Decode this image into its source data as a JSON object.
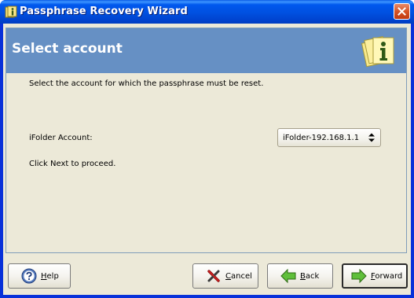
{
  "window": {
    "title": "Passphrase Recovery Wizard"
  },
  "header": {
    "title": "Select account",
    "icon": "ifolder-info-icon"
  },
  "content": {
    "instruction": "Select the account for which the passphrase must be reset.",
    "account_label": "iFolder Account:",
    "account_selected": "iFolder-192.168.1.1",
    "proceed_hint": "Click Next to proceed."
  },
  "buttons": {
    "help": {
      "mnemonic": "H",
      "rest": "elp"
    },
    "cancel": {
      "mnemonic": "C",
      "rest": "ancel"
    },
    "back": {
      "mnemonic": "B",
      "rest": "ack"
    },
    "forward": {
      "mnemonic": "F",
      "rest": "orward"
    }
  },
  "colors": {
    "titlebar": "#0054e3",
    "header_band": "#6690c4",
    "dialog_bg": "#ece9d8",
    "close_button": "#d65427"
  }
}
